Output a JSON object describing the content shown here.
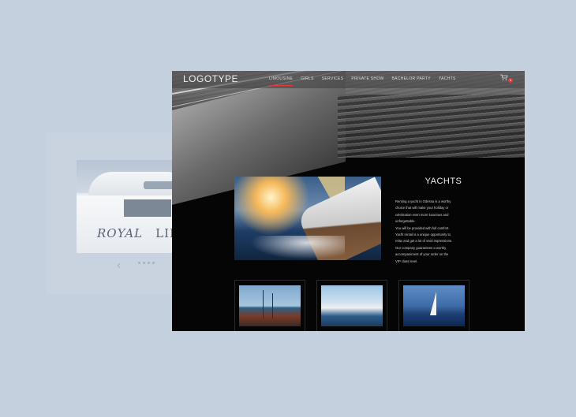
{
  "background_card": {
    "brand_word_1": "ROYAL",
    "brand_word_2": "LIFE",
    "prev_arrow": "‹",
    "dots": 4
  },
  "header": {
    "logo": "LOGOTYPE",
    "nav": [
      {
        "label": "LIMOUSINE",
        "active": true
      },
      {
        "label": "GIRLS",
        "active": false
      },
      {
        "label": "SERVICES",
        "active": false
      },
      {
        "label": "PRIVATE SHOW",
        "active": false
      },
      {
        "label": "BACHELOR PARTY",
        "active": false
      },
      {
        "label": "YACHTS",
        "active": false
      }
    ],
    "cart_icon": "cart-icon",
    "cart_count": "0"
  },
  "section": {
    "title": "YACHTS",
    "description": "Renting a yacht in Odessa is a worthy\nchoice that will make your holiday or\ncelebration even more luxurious and\nunforgettable.\nYou will be provided with full comfort.\nYacht rental is a unique opportunity to\nrelax and get a lot of vivid impressions.\nOur company guarantees a worthy\naccompaniment of your order on the\nVIP class level."
  },
  "colors": {
    "accent": "#e03a3a",
    "page_bg": "#c5d0de",
    "window_bg": "#050505"
  }
}
